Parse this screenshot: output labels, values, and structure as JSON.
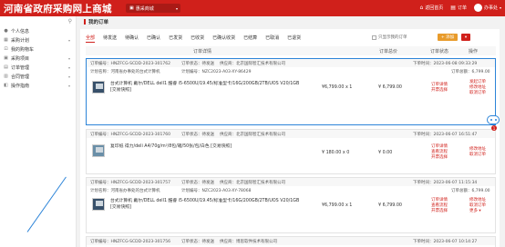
{
  "header": {
    "logo": "河南省政府采购网上商城",
    "mall_select": "惠采商城",
    "return_home": "返回首页",
    "orders_shortcut": "订单",
    "user_name": "办事处",
    "colors": {
      "brand_red": "#d0201b",
      "highlight_blue": "#2c84d8",
      "button_orange": "#e89b2b"
    }
  },
  "sidebar": {
    "collapse_icon": "pin-icon",
    "items": [
      {
        "label": "个人信息",
        "icon": "user-icon",
        "has_children": false
      },
      {
        "label": "采购计划",
        "icon": "plan-icon",
        "has_children": true
      },
      {
        "label": "我的购物车",
        "icon": "cart-icon",
        "has_children": false
      },
      {
        "label": "采购项目",
        "icon": "project-icon",
        "has_children": true
      },
      {
        "label": "订单管理",
        "icon": "order-icon",
        "has_children": true
      },
      {
        "label": "合同管理",
        "icon": "contract-icon",
        "has_children": true
      },
      {
        "label": "操作指南",
        "icon": "guide-icon",
        "has_children": true
      }
    ]
  },
  "page": {
    "title": "我的订单",
    "tabs": [
      "全部",
      "待发送",
      "待确认",
      "已确认",
      "已发货",
      "已收货",
      "已确认收货",
      "已结算",
      "已取消",
      "已退货"
    ],
    "active_tab": "全部",
    "only_current_label": "只显示我的订单",
    "add_button": "+ 添加",
    "columns": {
      "details": "订单详情",
      "total": "订单总价",
      "status": "订单状态",
      "ops": "操作"
    }
  },
  "orders": [
    {
      "order_no": "订单编号：HNZFCG-SCDD-2023-301762",
      "order_state": "订单状态：待发送",
      "supplier": "供应商：北京国际智汇技术有限公司",
      "time": "下单时间：2023-06-08 09:33:29",
      "plan_line": "计划名称：河南省办事处的台式计算机",
      "plan_no": "计划编号：NZC2023-A03-XY-86429",
      "total_line": "订单总额：6,799.00",
      "desc": "台式计算机 戴尔/DELL dell1 酷睿 i5-6500U/19.45/标准型卡/16G/200GB/2TB/UOS V20/1GB [交易快照]",
      "price": "¥6,799.00 x 1",
      "total": "¥ 6,799.00",
      "status_lines": [
        "订单详情",
        "开票选择"
      ],
      "ops_lines": [
        "发起订单",
        "修改地址",
        "取消订单"
      ]
    },
    {
      "order_no": "订单编号：HNZFCG-SCDD-2023-301760",
      "order_state": "订单状态：待发送",
      "supplier": "供应商：北京国际智汇技术有限公司",
      "time": "下单时间：2023-06-07 16:51:47",
      "desc": "复印纸 得力/deli A4/70g/m²/8包/箱/50张/包/白色 [交易快照]",
      "price": "¥ 180.00 x 0",
      "total": "¥ 0.00",
      "status_lines": [
        "订单详情",
        "查看流程",
        "开票选择"
      ],
      "ops_lines": [
        "修改地址",
        "取消订单"
      ]
    },
    {
      "order_no": "订单编号：HNZFCG-SCDD-2023-301757",
      "order_state": "订单状态：待发送",
      "supplier": "供应商：北京国际智汇技术有限公司",
      "time": "下单时间：2023-06-07 11:15:34",
      "plan_line": "计划名称：河南省办事处的台式计算机",
      "plan_no": "计划编号：NZC2023-A03-XY-78068",
      "total_line": "订单总额：6,799.00",
      "desc": "台式计算机 戴尔/DELL dell1 酷睿 i5-6500U/19.45/标准型卡/16G/200GB/2TB/UOS V20/1GB [交易快照]",
      "price": "¥6,799.00 x 1",
      "total": "¥ 6,799.00",
      "status_lines": [
        "订单详情",
        "查看流程",
        "开票选择"
      ],
      "ops_lines": [
        "修改地址",
        "取消订单",
        "更多 ▾"
      ]
    },
    {
      "order_no": "订单编号：HNZFCG-SCDD-2023-301756",
      "order_state": "订单状态：待发送",
      "supplier": "供应商：博思软件技术有限公司",
      "time": "下单时间：2023-06-07 10:14:27"
    }
  ],
  "assistant": {
    "icon": "robot-icon",
    "badge": "1"
  }
}
